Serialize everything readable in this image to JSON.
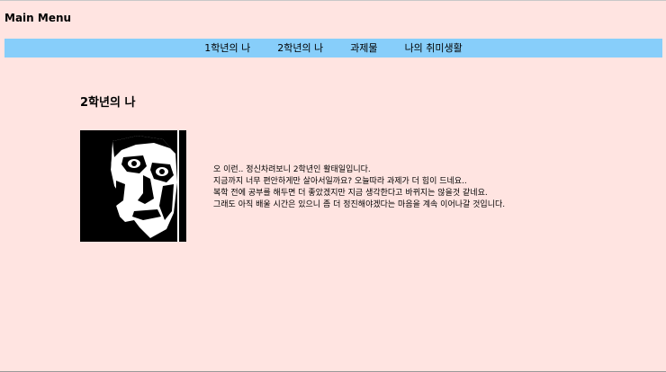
{
  "header": {
    "title": "Main Menu"
  },
  "nav": {
    "items": [
      {
        "label": "1학년의 나"
      },
      {
        "label": "2학년의 나"
      },
      {
        "label": "과제물"
      },
      {
        "label": "나의 취미생활"
      }
    ],
    "background": "#87cefa"
  },
  "main": {
    "heading": "2학년의 나",
    "image": {
      "icon": "portrait-illustration"
    },
    "paragraph_lines": [
      "오 이런.. 정신차려보니 2학년인 활태일입니다.",
      "지금까지 너무 편안하게만 살아서일까요? 오늘따라 과제가 더 힘이 드네요..",
      "복학 전에 공부를 해두면 더 좋았겠지만 지금 생각한다고 바뀌지는 않을것 같네요.",
      "그래도 아직 배울 시간은 있으니 좀 더 정진해야겠다는 마음을 계속 이어나갈 것입니다."
    ]
  },
  "colors": {
    "page_background": "#ffe4e1",
    "nav_background": "#87cefa"
  }
}
